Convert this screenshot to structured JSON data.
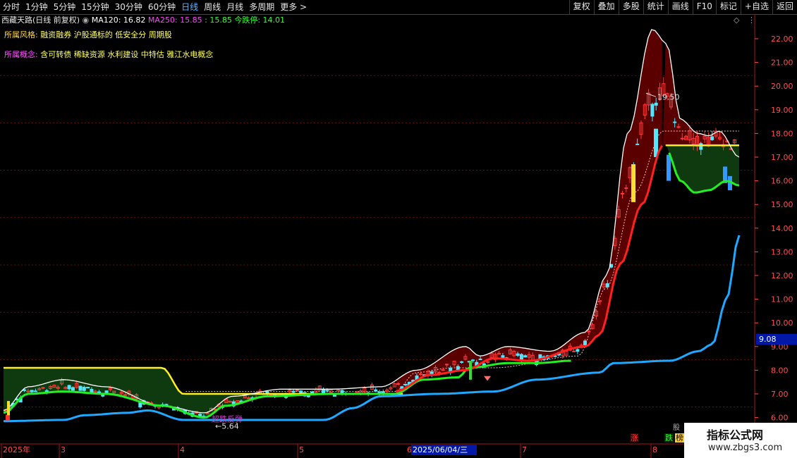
{
  "toolbar": {
    "periods": [
      "分时",
      "1分钟",
      "5分钟",
      "15分钟",
      "30分钟",
      "60分钟",
      "日线",
      "周线",
      "月线",
      "多周期",
      "更多 >"
    ],
    "active_period": "日线",
    "buttons": [
      "复权",
      "叠加",
      "多股",
      "统计",
      "画线",
      "F10",
      "标记",
      "+自选",
      "返回"
    ]
  },
  "stock": {
    "name": "西藏天路(日线 前复权)",
    "ma120_label": "MA120: 16.82",
    "ma250_label": "MA250: 15.85",
    "extra_label": ": 15.85",
    "limit_label": "今跌停: 14.01"
  },
  "tags": {
    "style_label": "所属风格:",
    "style_value": "融资融券 沪股通标的 低安全分 周期股",
    "concept_label": "所属概念:",
    "concept_value": "含可转债 稀缺资源 水利建设 中特估 雅江水电概念"
  },
  "price_axis": {
    "ticks": [
      "22.00",
      "21.00",
      "20.00",
      "19.00",
      "18.00",
      "17.00",
      "16.00",
      "15.00",
      "14.00",
      "13.00",
      "12.00",
      "11.00",
      "10.00",
      "9.00",
      "8.00",
      "7.00",
      "6.00"
    ],
    "current_price": "9.08"
  },
  "time_axis": {
    "labels": [
      "2025年",
      "3",
      "4",
      "5",
      "7",
      "8"
    ],
    "cursor_date": "2025/06/04/三",
    "cursor_prefix": "6"
  },
  "annotations": {
    "high": "19.50",
    "low": "5.64",
    "low_text": "超跌反弹"
  },
  "signals": {
    "zhang": "涨",
    "die": "跌",
    "bang": "榜",
    "truncated": "股"
  },
  "watermark": {
    "title": "指标公式网",
    "url": "www.zbgs3.com"
  },
  "colors": {
    "up": "#ff3b3b",
    "down": "#55e6ff",
    "upper_band": "#ffee22",
    "green_line": "#22ee22",
    "red_line": "#ff2020",
    "blue_line": "#20a8ff",
    "fill_red": "#5a0000",
    "fill_green": "#0f3a0f"
  }
}
